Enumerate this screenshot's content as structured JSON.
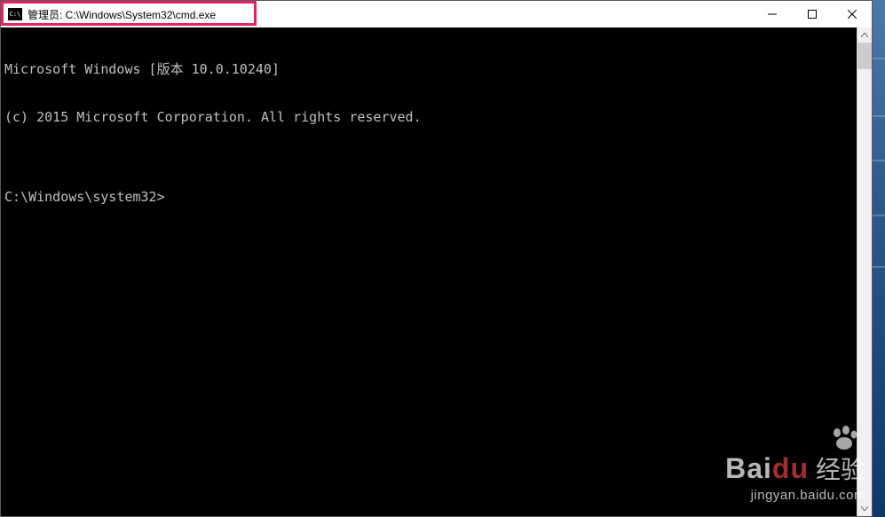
{
  "window": {
    "title": "管理员: C:\\Windows\\System32\\cmd.exe"
  },
  "terminal": {
    "line1": "Microsoft Windows [版本 10.0.10240]",
    "line2": "(c) 2015 Microsoft Corporation. All rights reserved.",
    "line3": "",
    "prompt": "C:\\Windows\\system32>"
  },
  "watermark": {
    "brand_bai": "Bai",
    "brand_du": "du",
    "brand_cn": "经验",
    "url": "jingyan.baidu.com"
  }
}
